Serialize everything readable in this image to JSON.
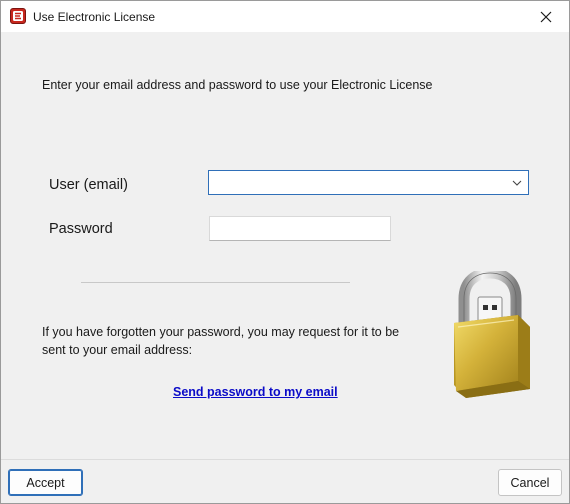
{
  "window": {
    "title": "Use Electronic License",
    "app_icon": "app-logo-icon",
    "close_icon": "close-icon"
  },
  "form": {
    "intro": "Enter your email address and password to use your Electronic License",
    "email_label": "User (email)",
    "email_value": "",
    "password_label": "Password",
    "password_value": ""
  },
  "recovery": {
    "message": "If you have forgotten your password, you may request for it to be sent to your email address:",
    "link_label": "Send password to my email"
  },
  "illustration": {
    "icon": "padlock-icon"
  },
  "buttons": {
    "accept_label": "Accept",
    "cancel_label": "Cancel"
  },
  "colors": {
    "focus_border": "#2f6fb8",
    "link": "#0b0bc8",
    "lock_body": "#d4b23a",
    "app_icon_bg": "#c8281e"
  }
}
